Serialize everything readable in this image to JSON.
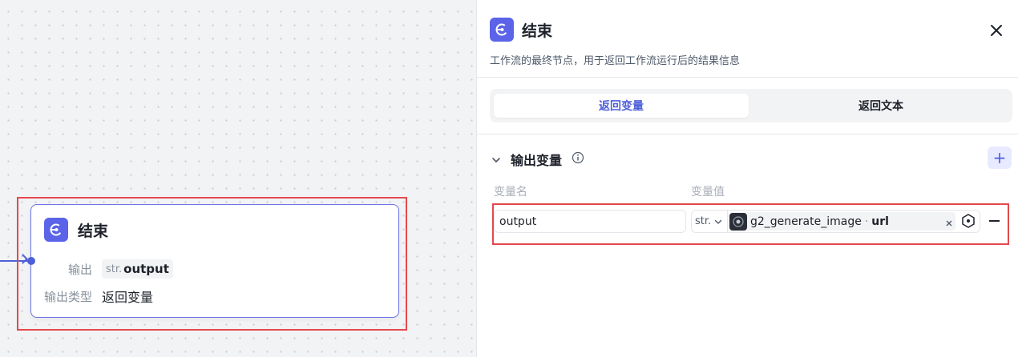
{
  "canvas": {
    "node": {
      "title": "结束",
      "output_label": "输出",
      "output_type_prefix": "str.",
      "output_name": "output",
      "output_type_label": "输出类型",
      "output_type_value": "返回变量"
    }
  },
  "panel": {
    "title": "结束",
    "description": "工作流的最终节点，用于返回工作流运行后的结果信息",
    "tabs": [
      {
        "label": "返回变量",
        "active": true
      },
      {
        "label": "返回文本",
        "active": false
      }
    ],
    "section": {
      "title": "输出变量",
      "add_label": "+"
    },
    "columns": {
      "name": "变量名",
      "value": "变量值"
    },
    "rows": [
      {
        "name": "output",
        "type": "str.",
        "source": "g2_generate_image",
        "separator": "·",
        "field": "url"
      }
    ]
  },
  "colors": {
    "accent": "#4e5fd9",
    "highlight": "#e5484d",
    "icon_bg": "#5b63e8"
  }
}
